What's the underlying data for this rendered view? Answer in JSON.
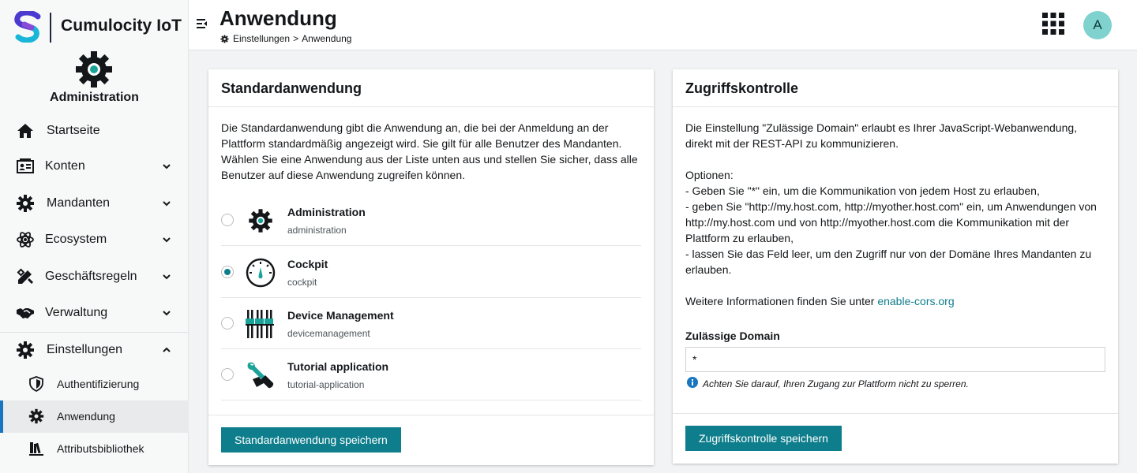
{
  "brand": {
    "name": "Cumulocity IoT"
  },
  "app": {
    "name": "Administration"
  },
  "sidebar": {
    "items": [
      {
        "label": "Startseite"
      },
      {
        "label": "Konten"
      },
      {
        "label": "Mandanten"
      },
      {
        "label": "Ecosystem"
      },
      {
        "label": "Geschäftsregeln"
      },
      {
        "label": "Verwaltung"
      },
      {
        "label": "Einstellungen"
      }
    ],
    "subitems": [
      {
        "label": "Authentifizierung"
      },
      {
        "label": "Anwendung"
      },
      {
        "label": "Attributsbibliothek"
      }
    ]
  },
  "header": {
    "title": "Anwendung",
    "breadcrumb": {
      "parent": "Einstellungen",
      "separator": ">",
      "current": "Anwendung"
    },
    "avatar_initial": "A"
  },
  "default_app": {
    "title": "Standardanwendung",
    "description": "Die Standardanwendung gibt die Anwendung an, die bei der Anmeldung an der Plattform standardmäßig angezeigt wird. Sie gilt für alle Benutzer des Mandanten. Wählen Sie eine Anwendung aus der Liste unten aus und stellen Sie sicher, dass alle Benutzer auf diese Anwendung zugreifen können.",
    "apps": [
      {
        "name": "Administration",
        "key": "administration",
        "icon": "gear-icon",
        "selected": false
      },
      {
        "name": "Cockpit",
        "key": "cockpit",
        "icon": "gauge-icon",
        "selected": true
      },
      {
        "name": "Device Management",
        "key": "devicemanagement",
        "icon": "device-management-icon",
        "selected": false
      },
      {
        "name": "Tutorial application",
        "key": "tutorial-application",
        "icon": "tools-icon",
        "selected": false
      }
    ],
    "save_label": "Standardanwendung speichern"
  },
  "access_control": {
    "title": "Zugriffskontrolle",
    "intro": "Die Einstellung \"Zulässige Domain\" erlaubt es Ihrer JavaScript-Webanwendung, direkt mit der REST-API zu kommunizieren.",
    "options_heading": "Optionen:",
    "option_1": "- Geben Sie \"*\" ein, um die Kommunikation von jedem Host zu erlauben,",
    "option_2": "- geben Sie \"http://my.host.com, http://myother.host.com\" ein, um Anwendungen von http://my.host.com und von http://myother.host.com die Kommunikation mit der Plattform zu erlauben,",
    "option_3": "- lassen Sie das Feld leer, um den Zugriff nur von der Domäne Ihres Mandanten zu erlauben.",
    "more_info_prefix": "Weitere Informationen finden Sie unter",
    "more_info_link": "enable-cors.org",
    "field_label": "Zulässige Domain",
    "field_value": "*",
    "help_text": "Achten Sie darauf, Ihren Zugang zur Plattform nicht zu sperren.",
    "save_label": "Zugriffskontrolle speichern"
  },
  "colors": {
    "accent": "#0f7e8c",
    "active_indicator": "#1776bf",
    "avatar": "#7fd2ce",
    "info": "#1776bf"
  }
}
